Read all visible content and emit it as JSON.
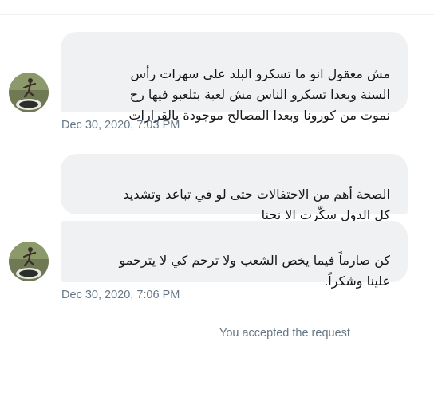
{
  "conversation": {
    "messages": [
      {
        "text": "مش معقول انو ما تسكرو البلد على سهرات رأس\nالسنة وبعدا تسكرو الناس مش لعبة بتلعبو فيها رح\nنموت من كورونا وبعدا المصالح موجودة بالقرارات"
      },
      {
        "text": "الصحة أهم من الاحتفالات  حتى لو في تباعد وتشديد\nكل الدول سكّرت  الا نحنا"
      },
      {
        "text": "كن صارماً فيما يخص الشعب ولا ترحم كي لا يترحمو\nعلينا وشكراً."
      }
    ],
    "timestamps": [
      "Dec 30, 2020, 7:03 PM",
      "Dec 30, 2020, 7:06 PM"
    ],
    "system_note": "You accepted the request"
  },
  "colors": {
    "bubble_background": "#eff1f3",
    "message_text": "#14171a",
    "meta_text": "#657786",
    "avatar_background": "#6f7a54"
  }
}
